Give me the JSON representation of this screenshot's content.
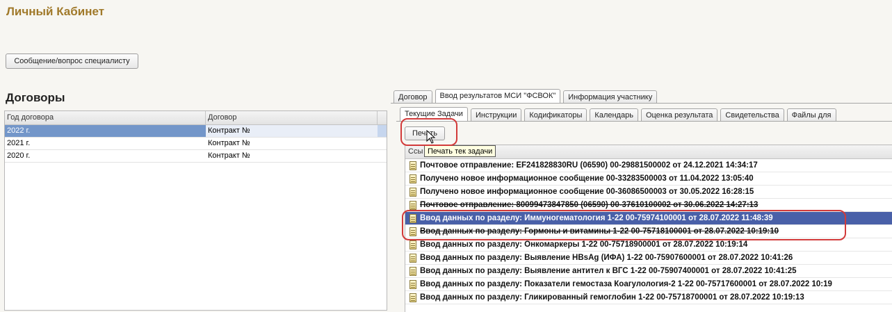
{
  "header": {
    "title": "Личный Кабинет"
  },
  "message_button": "Сообщение/вопрос специалисту",
  "contracts": {
    "title": "Договоры",
    "columns": [
      "Год договора",
      "Договор"
    ],
    "rows": [
      {
        "year": "2022 г.",
        "contract": "Контракт №"
      },
      {
        "year": "2021 г.",
        "contract": "Контракт №"
      },
      {
        "year": "2020 г.",
        "contract": "Контракт №"
      }
    ],
    "selected_index": 0
  },
  "top_tabs": [
    "Договор",
    "Ввод результатов МСИ \"ФСВОК\"",
    "Информация участнику"
  ],
  "top_tabs_active": 1,
  "sub_tabs": [
    "Текущие Задачи",
    "Инструкции",
    "Кодификаторы",
    "Календарь",
    "Оценка результата",
    "Свидетельства",
    "Файлы для"
  ],
  "sub_tabs_active": 0,
  "print_button": "Печать",
  "tooltip": "Печать тек задачи",
  "tasks_header": "Ссы",
  "tasks": [
    {
      "text": "Почтовое отправление: EF241828830RU (06590) 00-29881500002 от 24.12.2021 14:34:17",
      "state": "normal"
    },
    {
      "text": "Получено новое информационное сообщение 00-33283500003 от 11.04.2022 13:05:40",
      "state": "normal"
    },
    {
      "text": "Получено новое информационное сообщение 00-36086500003 от 30.05.2022 16:28:15",
      "state": "normal"
    },
    {
      "text": "Почтовое отправление: 80099473847850 (06590) 00-37610100002 от 30.06.2022 14:27:13",
      "state": "strike"
    },
    {
      "text": "Ввод данных по разделу: Иммуногематология 1-22 00-75974100001 от 28.07.2022 11:48:39",
      "state": "selected"
    },
    {
      "text": "Ввод данных по разделу: Гормоны и витамины 1-22 00-75718100001 от 28.07.2022 10:19:10",
      "state": "strike"
    },
    {
      "text": "Ввод данных по разделу: Онкомаркеры 1-22 00-75718900001 от 28.07.2022 10:19:14",
      "state": "normal"
    },
    {
      "text": "Ввод данных по разделу: Выявление HBsAg (ИФА) 1-22 00-75907600001 от 28.07.2022 10:41:26",
      "state": "normal"
    },
    {
      "text": "Ввод данных по разделу: Выявление антител к ВГС 1-22 00-75907400001 от 28.07.2022 10:41:25",
      "state": "normal"
    },
    {
      "text": "Ввод данных по разделу: Показатели гемостаза Коагулология-2 1-22 00-75717600001 от 28.07.2022 10:19",
      "state": "normal"
    },
    {
      "text": "Ввод данных по разделу: Гликированный гемоглобин 1-22 00-75718700001 от 28.07.2022 10:19:13",
      "state": "normal"
    }
  ],
  "colors": {
    "title": "#a0792a",
    "selection": "#4960a8",
    "highlight": "#d23a3a"
  }
}
